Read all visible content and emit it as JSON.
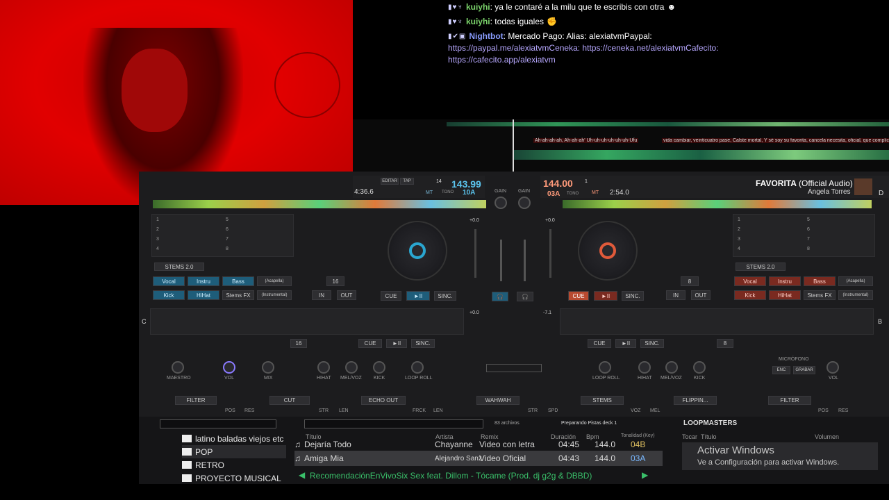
{
  "chat": {
    "messages": [
      {
        "badges": "▮♥♆",
        "user": "kuiyhi",
        "text": ": ya le contaré a la milu que te escribis con otra",
        "emote": "☻"
      },
      {
        "badges": "▮♥♆",
        "user": "kuiyhi",
        "text": ": todas iguales",
        "emote": "✊"
      },
      {
        "badges": "▮✔▣",
        "user": "Nightbot",
        "text": ": Mercado Pago: Alias: alexiatvmPaypal:",
        "emote": ""
      }
    ],
    "links": [
      "https://paypal.me/alexiatvmCeneka: https://ceneka.net/alexiatvmCafecito:",
      "https://cafecito.app/alexiatvm"
    ]
  },
  "lyrics": {
    "left": "Ah-ah-ah-ah, Ah-ah-ah' Uh-uh-uh-uh-uh-uh-Ufu",
    "right": "vida cambiar, veinticuatro pase, Calste mortal,   Y sé soy su favorita, cancela necesita, oficial, que complic"
  },
  "deck_left": {
    "time": "4:36.6",
    "bpm": "143.99",
    "pitch": "14",
    "key": "10A",
    "edit_label": "EDITAR",
    "tap_label": "TAP",
    "tono": "TONO",
    "mt": "MT",
    "stems": "STEMS 2.0",
    "stem_buttons": [
      "Vocal",
      "Instru",
      "Bass",
      "(Acapella)",
      "Kick",
      "HiHat",
      "Stems FX",
      "(Instrumental)"
    ],
    "cue_label": "CUE",
    "play_label": "►II",
    "sync_label": "SINC.",
    "loop_value": "16",
    "in_label": "IN",
    "out_label": "OUT",
    "hotcues": [
      "1",
      "2",
      "3",
      "4",
      "5",
      "6",
      "7",
      "8"
    ],
    "pitch_value": "+0.0"
  },
  "deck_right": {
    "bpm": "144.00",
    "deck_num": "1",
    "time": "2:54.0",
    "key": "03A",
    "tono": "TONO",
    "mt": "MT",
    "title": "FAVORITA",
    "title_suffix": "(Official Audio)",
    "artist": "Ángela Torres",
    "letter": "D",
    "stems": "STEMS 2.0",
    "stem_buttons": [
      "Vocal",
      "Instru",
      "Bass",
      "(Acapella)",
      "Kick",
      "HiHat",
      "Stems FX",
      "(Instrumental)"
    ],
    "cue_label": "CUE",
    "play_label": "►II",
    "sync_label": "SINC.",
    "loop_value": "8",
    "in_label": "IN",
    "out_label": "OUT",
    "hotcues": [
      "1",
      "2",
      "3",
      "4",
      "5",
      "6",
      "7",
      "8"
    ],
    "pitch_value": "+0.0"
  },
  "deck_c": {
    "letter": "C",
    "loop_value": "16",
    "cue_label": "CUE",
    "play_label": "►II",
    "sync_label": "SINC.",
    "pitch_value": "+0.0"
  },
  "deck_b": {
    "letter": "B",
    "loop_value": "8",
    "cue_label": "CUE",
    "play_label": "►II",
    "sync_label": "SINC.",
    "pitch_value": "-7.1"
  },
  "mixer": {
    "gain": "GAIN",
    "maestro": "MAESTRO",
    "vol": "VOL",
    "mix": "MIX",
    "hihat": "HIHAT",
    "melvoz": "MEL/VOZ",
    "kick": "KICK",
    "loop_roll": "LOOP ROLL",
    "microfono": "MICRÓFONO",
    "enc": "ENC",
    "grabar": "GRABAR"
  },
  "fx": {
    "left": [
      "FILTER",
      "CUT",
      "ECHO OUT"
    ],
    "center": "WAHWAH",
    "right": [
      "STEMS",
      "FLIPPIN...",
      "FILTER"
    ],
    "knob_labels": [
      "POS",
      "RES",
      "STR",
      "LEN",
      "FRCK",
      "LEN",
      "STR",
      "SPD",
      "VOZ",
      "MEL",
      "POS",
      "RES"
    ]
  },
  "browser": {
    "folders": [
      "latino baladas viejos etc",
      "POP",
      "RETRO",
      "PROYECTO MUSICAL"
    ],
    "file_count": "83 archivos",
    "status": "Preparando Pistas deck 1",
    "columns": [
      "Título",
      "Artista",
      "Remix",
      "Duración",
      "Bpm",
      "Tonalidad (Key)"
    ],
    "tracks": [
      {
        "title": "Dejaría Todo",
        "artist": "Chayanne",
        "remix": "Video con letra",
        "duration": "04:45",
        "bpm": "144.0",
        "key": "04B"
      },
      {
        "title": "Amiga Mia",
        "artist": "Alejandro Sanz",
        "remix": "Video Oficial",
        "duration": "04:43",
        "bpm": "144.0",
        "key": "03A"
      }
    ],
    "recommendation": "RecomendaciónEnVivoSix Sex feat. Dillom - Tócame (Prod. dj g2g & DBBD)",
    "loopmasters": "LOOPMASTERS",
    "side_columns": [
      "Tocar",
      "Título",
      "Volumen"
    ]
  },
  "windows": {
    "activate": "Activar Windows",
    "subtitle": "Ve a Configuración para activar Windows."
  }
}
